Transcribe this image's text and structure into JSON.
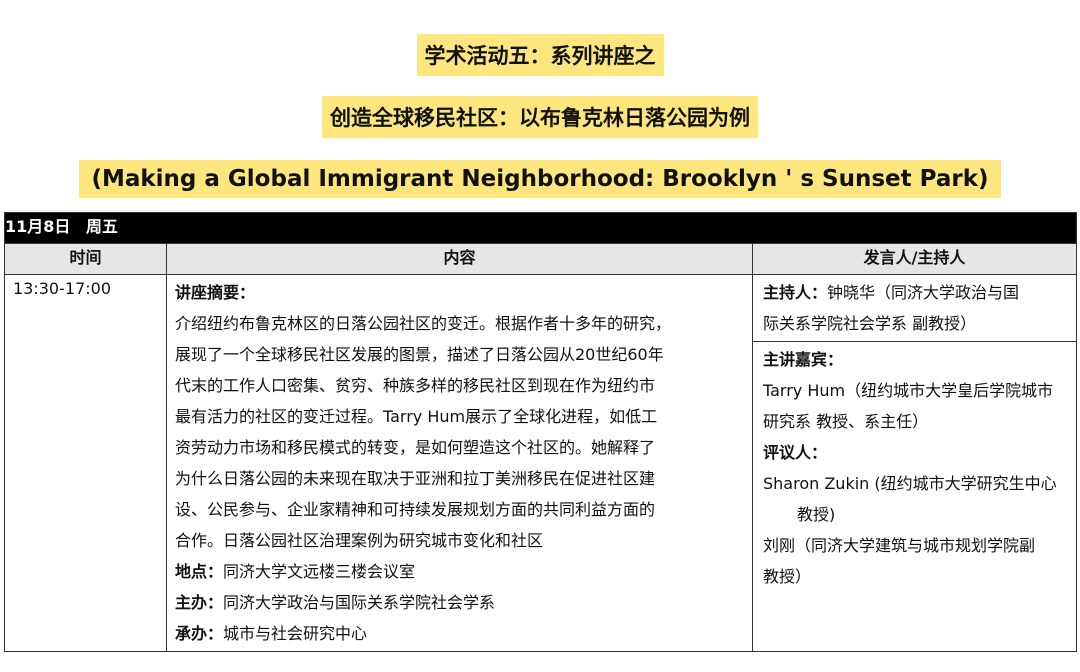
{
  "titles": {
    "line1": "学术活动五：系列讲座之",
    "line2": "创造全球移民社区：以布鲁克林日落公园为例",
    "line3": "(Making a Global Immigrant Neighborhood: Brooklyn ' s Sunset Park)"
  },
  "table": {
    "date": "11月8日",
    "weekday": "周五",
    "headers": [
      "时间",
      "内容",
      "发言人/主持人"
    ],
    "time": "13:30-17:00",
    "content": {
      "abstract_label": "讲座摘要：",
      "abstract_lines": [
        "介绍纽约布鲁克林区的日落公园社区的变迁。根据作者十多年的研究，",
        "展现了一个全球移民社区发展的图景，描述了日落公园从20世纪60年",
        "代末的工作人口密集、贫穷、种族多样的移民社区到现在作为纽约市",
        "最有活力的社区的变迁过程。Tarry Hum展示了全球化进程，如低工",
        "资劳动力市场和移民模式的转变，是如何塑造这个社区的。她解释了",
        "为什么日落公园的未来现在取决于亚洲和拉丁美洲移民在促进社区建",
        "设、公民参与、企业家精神和可持续发展规划方面的共同利益方面的",
        "合作。日落公园社区治理案例为研究城市变化和社区"
      ],
      "location_label": "地点：",
      "location": "同济大学文远楼三楼会议室",
      "host_label": "主办：",
      "host": "同济大学政治与国际关系学院社会学系",
      "organizer_label": "承办：",
      "organizer": "城市与社会研究中心"
    },
    "speakers": {
      "moderator_label": "主持人：",
      "moderator_line1": "钟晓华（同济大学政治与国",
      "moderator_line2": "际关系学院社会学系  副教授）",
      "keynote_label": "主讲嘉宾：",
      "keynote_line1": "Tarry Hum（纽约城市大学皇后学院城市",
      "keynote_line2": "研究系  教授、系主任）",
      "reviewer_label": "评议人：",
      "reviewer1_line1": "Sharon Zukin (纽约城市大学研究生中心",
      "reviewer1_line2": "教授)",
      "reviewer2_line1": "刘刚（同济大学建筑与城市规划学院副",
      "reviewer2_line2": "教授）"
    }
  }
}
